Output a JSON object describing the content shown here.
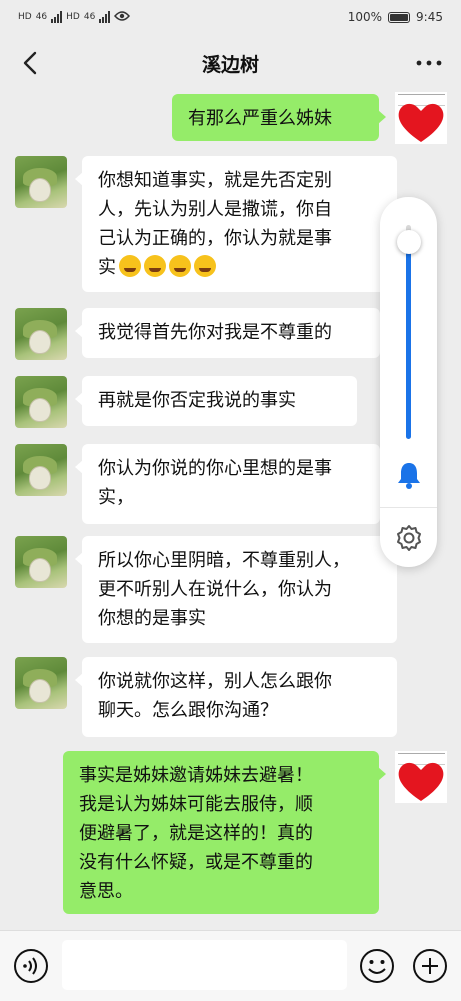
{
  "status_bar": {
    "hd1": "HD",
    "hd2": "HD",
    "net1": "46",
    "net2": "46",
    "battery_pct": "100%",
    "time": "9:45"
  },
  "header": {
    "title": "溪边树",
    "back_icon": "chevron-left-icon",
    "more_icon": "more-dots-icon"
  },
  "messages": [
    {
      "from": "me",
      "text": "有那么严重么姊妹"
    },
    {
      "from": "other",
      "lines": [
        "你想知道事实，就是先否定别",
        "人，先认为别人是撒谎，你自",
        "己认为正确的，你认为就是事",
        "实"
      ],
      "emojis": 4
    },
    {
      "from": "other",
      "text": "我觉得首先你对我是不尊重的"
    },
    {
      "from": "other",
      "text": "再就是你否定我说的事实"
    },
    {
      "from": "other",
      "lines": [
        "你认为你说的你心里想的是事",
        "实，"
      ]
    },
    {
      "from": "other",
      "lines": [
        "所以你心里阴暗，不尊重别人，",
        "更不听别人在说什么，你认为",
        "你想的是事实"
      ]
    },
    {
      "from": "other",
      "lines": [
        "你说就你这样，别人怎么跟你",
        "聊天。怎么跟你沟通？"
      ]
    },
    {
      "from": "me",
      "lines": [
        "事实是姊妹邀请姊妹去避暑！",
        "我是认为姊妹可能去服侍，顺",
        "便避暑了，就是这样的！真的",
        "没有什么怀疑，或是不尊重的",
        "意思。"
      ]
    }
  ],
  "volume_panel": {
    "level": 0.92,
    "accent": "#1a73e8",
    "bell_icon": "bell-icon",
    "gear_icon": "gear-icon"
  },
  "input_bar": {
    "voice_icon": "voice-icon",
    "emoji_icon": "emoji-icon",
    "plus_icon": "plus-icon"
  },
  "colors": {
    "my_bubble": "#95ec69",
    "their_bubble": "#ffffff",
    "background": "#ededed"
  }
}
